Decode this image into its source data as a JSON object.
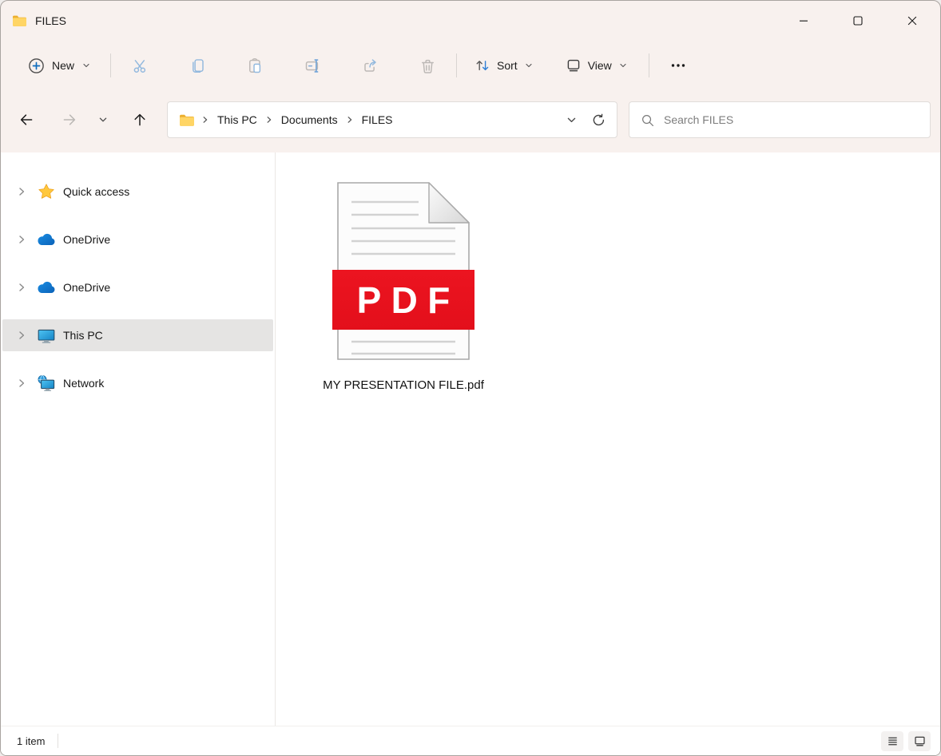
{
  "window": {
    "title": "FILES"
  },
  "toolbar": {
    "new_label": "New",
    "sort_label": "Sort",
    "view_label": "View"
  },
  "navigation": {
    "breadcrumb": [
      "This PC",
      "Documents",
      "FILES"
    ],
    "search_placeholder": "Search FILES"
  },
  "sidebar": {
    "items": [
      {
        "label": "Quick access",
        "icon": "star-icon",
        "selected": false
      },
      {
        "label": "OneDrive",
        "icon": "onedrive-cloud-icon",
        "selected": false
      },
      {
        "label": "OneDrive",
        "icon": "onedrive-cloud-icon",
        "selected": false
      },
      {
        "label": "This PC",
        "icon": "monitor-icon",
        "selected": true
      },
      {
        "label": "Network",
        "icon": "network-globe-icon",
        "selected": false
      }
    ]
  },
  "content": {
    "files": [
      {
        "name": "MY PRESENTATION FILE.pdf",
        "badge": "PDF",
        "type": "pdf"
      }
    ]
  },
  "statusbar": {
    "count": "1 item"
  },
  "icons": {
    "titlebar": [
      "folder-icon",
      "minimize-icon",
      "maximize-icon",
      "close-icon"
    ],
    "toolbar": [
      "plus-circle-icon",
      "cut-icon",
      "copy-icon",
      "paste-icon",
      "rename-icon",
      "share-icon",
      "delete-icon",
      "sort-arrows-icon",
      "view-icon",
      "more-dots-icon"
    ],
    "navbar": [
      "back-arrow-icon",
      "forward-arrow-icon",
      "chevron-down-icon",
      "up-arrow-icon",
      "folder-icon",
      "refresh-icon",
      "search-icon"
    ],
    "statusbar": [
      "details-view-icon",
      "thumbnails-view-icon"
    ]
  },
  "colors": {
    "chrome_bg": "#f8f1ee",
    "pdf_red": "#e8121c",
    "folder_gold": "#ffc940",
    "accent_blue": "#0f6cbd",
    "selected_row": "#e5e4e3"
  }
}
